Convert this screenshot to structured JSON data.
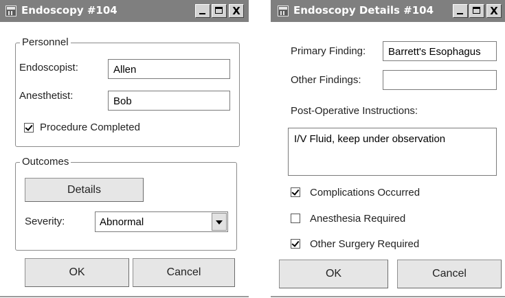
{
  "left_window": {
    "title": "Endoscopy #104",
    "title_buttons": {
      "minimize": "_",
      "maximize": "□",
      "close": "X"
    },
    "personnel": {
      "legend": "Personnel",
      "endoscopist_label": "Endoscopist:",
      "endoscopist_value": "Allen",
      "anesthetist_label": "Anesthetist:",
      "anesthetist_value": "Bob",
      "procedure_completed_label": "Procedure Completed",
      "procedure_completed_checked": true
    },
    "outcomes": {
      "legend": "Outcomes",
      "details_button": "Details",
      "severity_label": "Severity:",
      "severity_value": "Abnormal"
    },
    "ok_button": "OK",
    "cancel_button": "Cancel"
  },
  "right_window": {
    "title": "Endoscopy Details #104",
    "title_buttons": {
      "minimize": "_",
      "maximize": "□",
      "close": "X"
    },
    "primary_finding_label": "Primary Finding:",
    "primary_finding_value": "Barrett's Esophagus",
    "other_findings_label": "Other Findings:",
    "other_findings_value": "",
    "post_op_label": "Post-Operative Instructions:",
    "post_op_value": "I/V Fluid, keep under observation",
    "complications_label": "Complications Occurred",
    "complications_checked": true,
    "anesthesia_label": "Anesthesia Required",
    "anesthesia_checked": false,
    "other_surgery_label": "Other Surgery Required",
    "other_surgery_checked": true,
    "ok_button": "OK",
    "cancel_button": "Cancel"
  }
}
